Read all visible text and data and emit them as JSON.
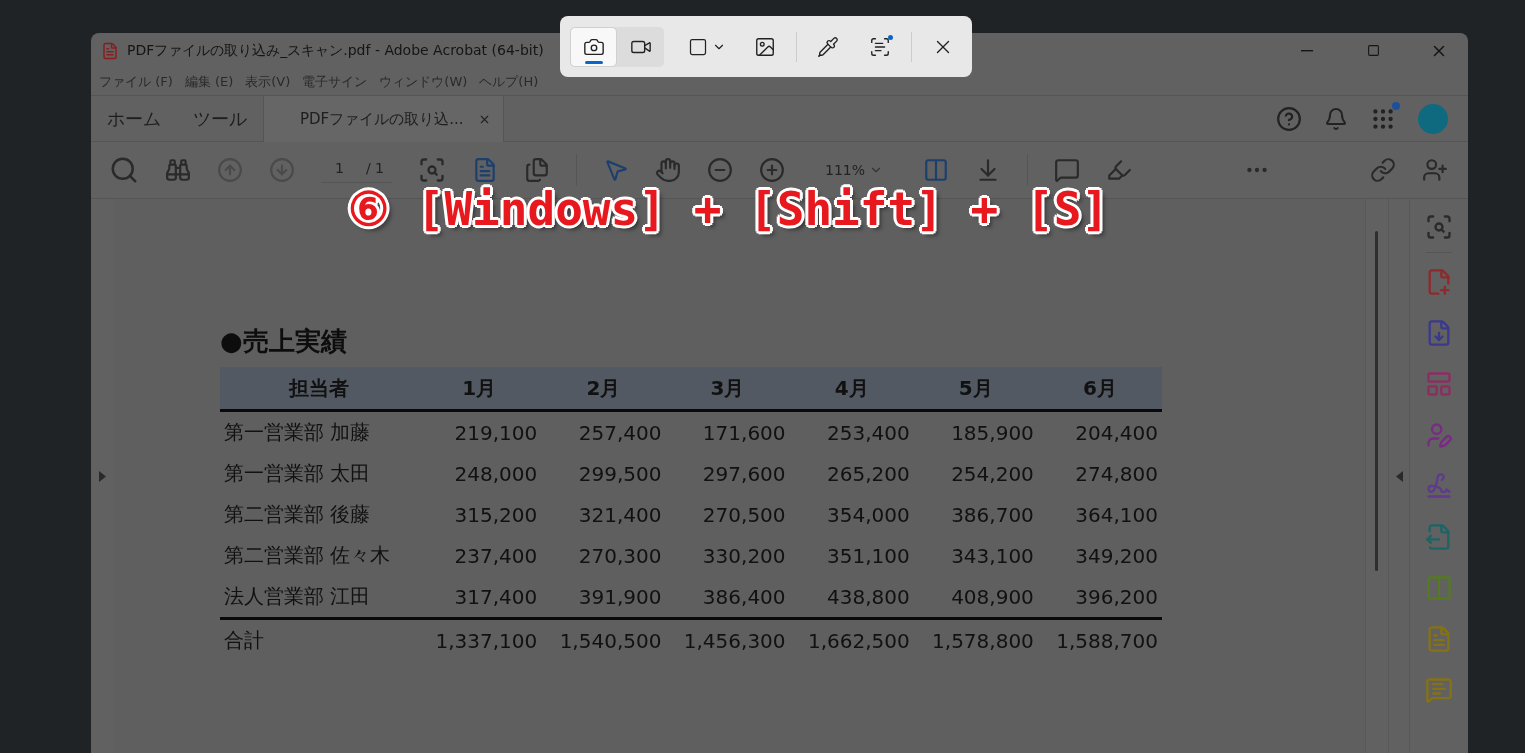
{
  "snip_toolbar": {
    "modes": [
      {
        "selected": true
      },
      {
        "selected": false
      }
    ],
    "text_actions_badge": true
  },
  "window": {
    "title": "PDFファイルの取り込み_スキャン.pdf - Adobe Acrobat (64-bit)"
  },
  "menu": [
    {
      "label": "ファイル (F)"
    },
    {
      "label": "編集 (E)"
    },
    {
      "label": "表示(V)"
    },
    {
      "label": "電子サイン"
    },
    {
      "label": "ウィンドウ(W)"
    },
    {
      "label": "ヘルプ(H)"
    }
  ],
  "tabs": [
    {
      "label": "ホーム",
      "selected": false,
      "closable": false
    },
    {
      "label": "ツール",
      "selected": false,
      "closable": false
    },
    {
      "label": "PDFファイルの取り込...",
      "selected": true,
      "closable": true
    }
  ],
  "toolbar": {
    "page": "1",
    "page_total": "/ 1",
    "zoom": "111%"
  },
  "caption": "⑥ [Windows] + [Shift] + [S]",
  "document": {
    "heading": "●売上実績",
    "columns": [
      "担当者",
      "1月",
      "2月",
      "3月",
      "4月",
      "5月",
      "6月"
    ],
    "rows": [
      {
        "cells": [
          "第一営業部 加藤",
          "219,100",
          "257,400",
          "171,600",
          "253,400",
          "185,900",
          "204,400"
        ]
      },
      {
        "cells": [
          "第一営業部 太田",
          "248,000",
          "299,500",
          "297,600",
          "265,200",
          "254,200",
          "274,800"
        ]
      },
      {
        "cells": [
          "第二営業部 後藤",
          "315,200",
          "321,400",
          "270,500",
          "354,000",
          "386,700",
          "364,100"
        ]
      },
      {
        "cells": [
          "第二営業部 佐々木",
          "237,400",
          "270,300",
          "330,200",
          "351,100",
          "343,100",
          "349,200"
        ]
      },
      {
        "cells": [
          "法人営業部 江田",
          "317,400",
          "391,900",
          "386,400",
          "438,800",
          "408,900",
          "396,200"
        ]
      }
    ],
    "total": {
      "cells": [
        "合計",
        "1,337,100",
        "1,540,500",
        "1,456,300",
        "1,662,500",
        "1,578,800",
        "1,588,700"
      ]
    }
  }
}
